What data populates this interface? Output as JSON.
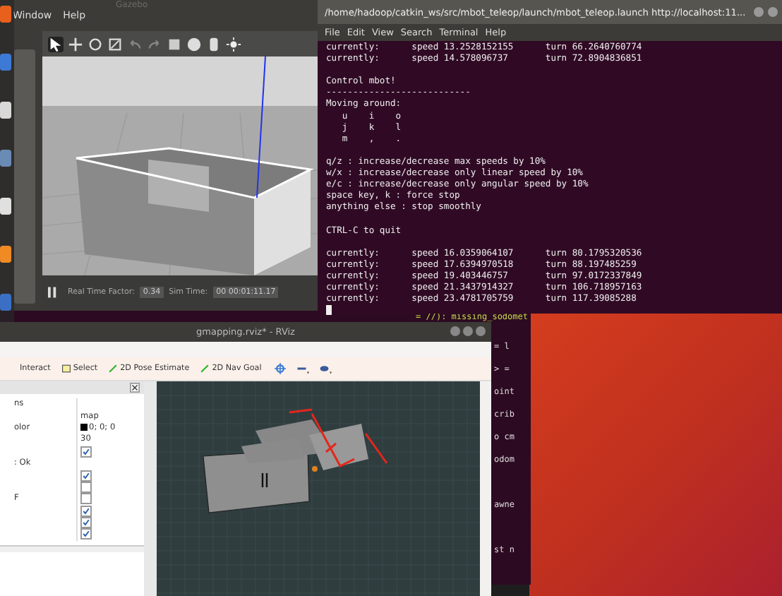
{
  "gazebo": {
    "title": "Gazebo",
    "menu": [
      "Window",
      "Help"
    ],
    "real_time_factor_label": "Real Time Factor:",
    "real_time_factor": "0.34",
    "sim_time_label": "Sim Time:",
    "sim_time": "00 00:01:11.17"
  },
  "terminal": {
    "title": "/home/hadoop/catkin_ws/src/mbot_teleop/launch/mbot_teleop.launch http://localhost:11...",
    "menu": [
      "File",
      "Edit",
      "View",
      "Search",
      "Terminal",
      "Help"
    ],
    "blocks": [
      [
        "currently:      speed 13.2528152155      turn 66.2640760774",
        "currently:      speed 14.578096737       turn 72.8904836851"
      ],
      [
        "Control mbot!",
        "---------------------------",
        "Moving around:",
        "   u    i    o",
        "   j    k    l",
        "   m    ,    ."
      ],
      [
        "q/z : increase/decrease max speeds by 10%",
        "w/x : increase/decrease only linear speed by 10%",
        "e/c : increase/decrease only angular speed by 10%",
        "space key, k : force stop",
        "anything else : stop smoothly"
      ],
      [
        "CTRL-C to quit"
      ],
      [
        "currently:      speed 16.0359064107      turn 80.1795320536",
        "currently:      speed 17.6394970518      turn 88.197485259",
        "currently:      speed 19.403446757       turn 97.0172337849",
        "currently:      speed 21.3437914327      turn 106.718957163",
        "currently:      speed 23.4781705759      turn 117.39085288"
      ]
    ]
  },
  "back_terminal": {
    "top_line": "= //): missing_sodomet",
    "blocks": [
      [
        "= l",
        "> =",
        "oint",
        "crib",
        "o cm",
        "odom"
      ],
      [
        "awne"
      ],
      [
        "st n"
      ]
    ]
  },
  "rviz": {
    "title": "gmapping.rviz* - RViz",
    "tools": [
      {
        "label": "Interact",
        "kind": "interact"
      },
      {
        "label": "Select",
        "kind": "select"
      },
      {
        "label": "2D Pose Estimate",
        "kind": "pose"
      },
      {
        "label": "2D Nav Goal",
        "kind": "goal"
      }
    ],
    "properties": [
      {
        "name": "ns",
        "kind": "text"
      },
      {
        "value": "map",
        "kind": "text"
      },
      {
        "name": "olor",
        "value": "0; 0; 0",
        "kind": "color",
        "color": "#000000"
      },
      {
        "value": "30",
        "kind": "text"
      },
      {
        "kind": "checkbox",
        "checked": true
      },
      {
        "name": ": Ok",
        "kind": "text"
      },
      {
        "kind": "checkbox",
        "checked": true
      },
      {
        "kind": "checkbox",
        "checked": false
      },
      {
        "name": "F",
        "kind": "checkbox",
        "checked": false
      },
      {
        "kind": "checkbox",
        "checked": true
      },
      {
        "kind": "checkbox",
        "checked": true
      },
      {
        "kind": "checkbox",
        "checked": true
      }
    ]
  }
}
